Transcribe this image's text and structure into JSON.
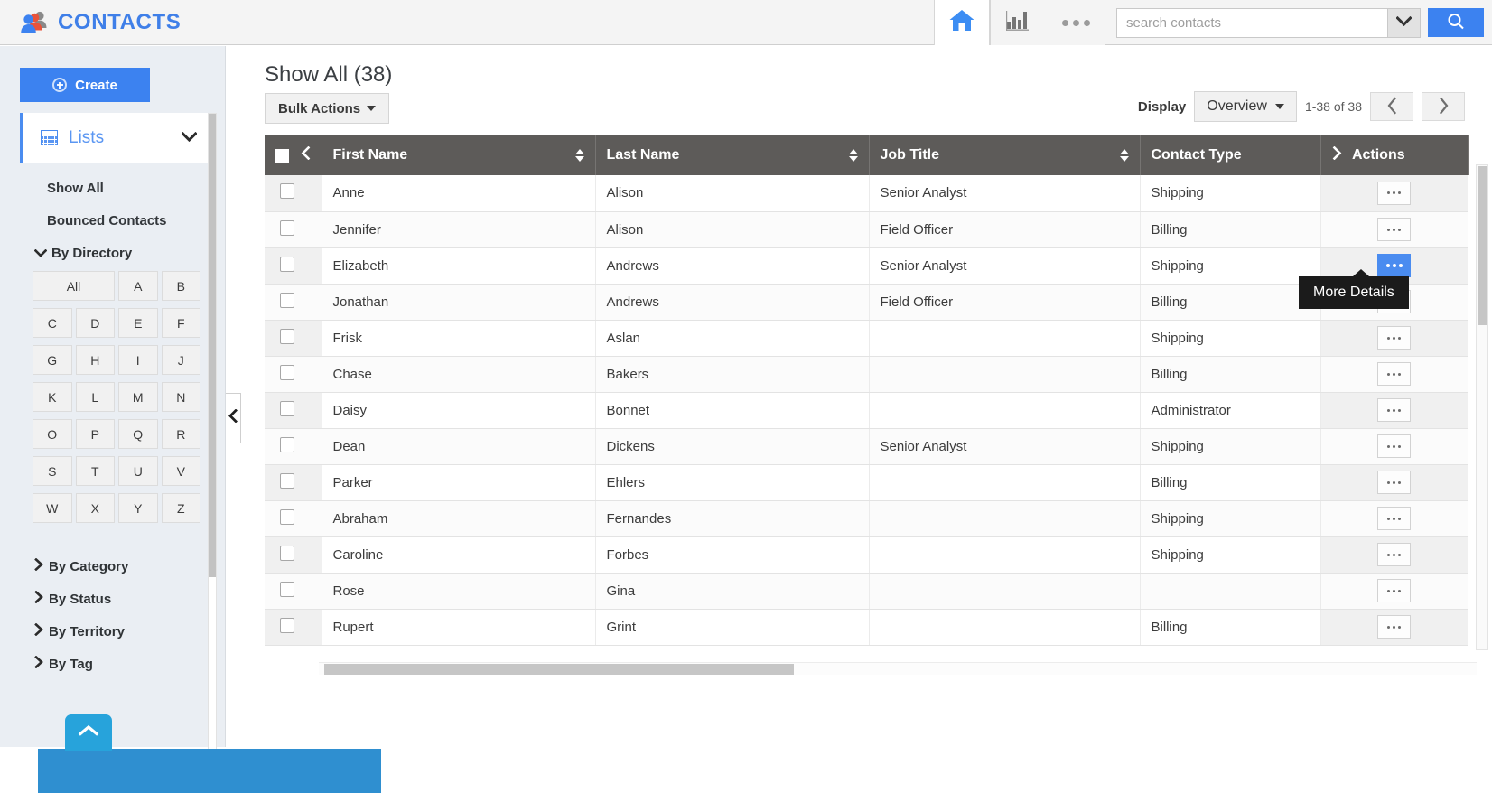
{
  "app": {
    "brand_title": "CONTACTS"
  },
  "topnav": {
    "home_icon": "home-icon",
    "reports_icon": "bar-chart-icon",
    "more_icon": "ellipsis-icon",
    "search_placeholder": "search contacts",
    "search_value": "",
    "search_dropdown_icon": "chevron-down-icon",
    "search_button_icon": "search-icon"
  },
  "sidebar": {
    "create_label": "Create",
    "lists_label": "Lists",
    "links": [
      {
        "label": "Show All"
      },
      {
        "label": "Bounced Contacts"
      }
    ],
    "by_directory_label": "By Directory",
    "alphabet": [
      "All",
      "A",
      "B",
      "C",
      "D",
      "E",
      "F",
      "G",
      "H",
      "I",
      "J",
      "K",
      "L",
      "M",
      "N",
      "O",
      "P",
      "Q",
      "R",
      "S",
      "T",
      "U",
      "V",
      "W",
      "X",
      "Y",
      "Z"
    ],
    "groups": [
      {
        "label": "By Category"
      },
      {
        "label": "By Status"
      },
      {
        "label": "By Territory"
      },
      {
        "label": "By Tag"
      }
    ],
    "collapse_icon": "chevron-left-icon",
    "scroll_top_icon": "chevron-up-icon"
  },
  "main": {
    "page_title": "Show All (38)",
    "bulk_actions_label": "Bulk Actions",
    "display_label": "Display",
    "display_value": "Overview",
    "range_text": "1-38 of 38",
    "prev_icon": "chevron-left-icon",
    "next_icon": "chevron-right-icon"
  },
  "table": {
    "columns": [
      {
        "key": "check",
        "label": ""
      },
      {
        "key": "first",
        "label": "First Name",
        "sortable": true
      },
      {
        "key": "last",
        "label": "Last Name",
        "sortable": true
      },
      {
        "key": "job",
        "label": "Job Title",
        "sortable": true
      },
      {
        "key": "type",
        "label": "Contact Type",
        "sortable": false
      },
      {
        "key": "actions",
        "label": "Actions",
        "sortable": false
      }
    ],
    "rows": [
      {
        "first": "Anne",
        "last": "Alison",
        "job": "Senior Analyst",
        "type": "Shipping"
      },
      {
        "first": "Jennifer",
        "last": "Alison",
        "job": "Field Officer",
        "type": "Billing"
      },
      {
        "first": "Elizabeth",
        "last": "Andrews",
        "job": "Senior Analyst",
        "type": "Shipping"
      },
      {
        "first": "Jonathan",
        "last": "Andrews",
        "job": "Field Officer",
        "type": "Billing"
      },
      {
        "first": "Frisk",
        "last": "Aslan",
        "job": "",
        "type": "Shipping"
      },
      {
        "first": "Chase",
        "last": "Bakers",
        "job": "",
        "type": "Billing"
      },
      {
        "first": "Daisy",
        "last": "Bonnet",
        "job": "",
        "type": "Administrator"
      },
      {
        "first": "Dean",
        "last": "Dickens",
        "job": "Senior Analyst",
        "type": "Shipping"
      },
      {
        "first": "Parker",
        "last": "Ehlers",
        "job": "",
        "type": "Billing"
      },
      {
        "first": "Abraham",
        "last": "Fernandes",
        "job": "",
        "type": "Shipping"
      },
      {
        "first": "Caroline",
        "last": "Forbes",
        "job": "",
        "type": "Shipping"
      },
      {
        "first": "Rose",
        "last": "Gina",
        "job": "",
        "type": ""
      },
      {
        "first": "Rupert",
        "last": "Grint",
        "job": "",
        "type": "Billing"
      }
    ],
    "action_button_icon": "ellipsis-icon",
    "hovered_row_index": 2,
    "tooltip_text": "More Details"
  },
  "colors": {
    "accent_blue": "#3c82f0",
    "header_gray": "#5d5b59",
    "sidebar_bg": "#eaeef3",
    "tooltip_bg": "#1b1b1b",
    "scroll_top_blue": "#27a3db"
  }
}
